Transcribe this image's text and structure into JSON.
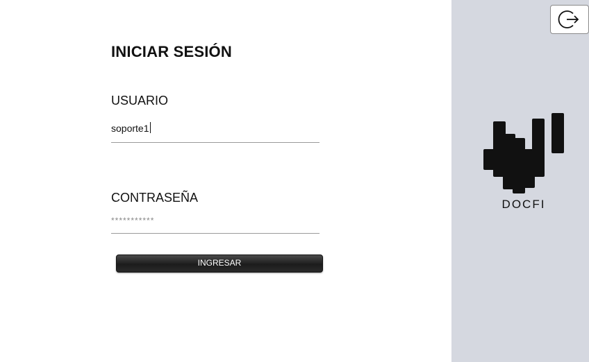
{
  "login": {
    "title": "INICIAR SESIÓN",
    "username_label": "USUARIO",
    "username_value": "soporte1",
    "password_label": "CONTRASEÑA",
    "password_placeholder": "***********",
    "submit_label": "INGRESAR"
  },
  "brand": {
    "name": "DOCFI",
    "panel_color": "#d5d8e0"
  },
  "header": {
    "logout_icon": "logout-icon"
  }
}
